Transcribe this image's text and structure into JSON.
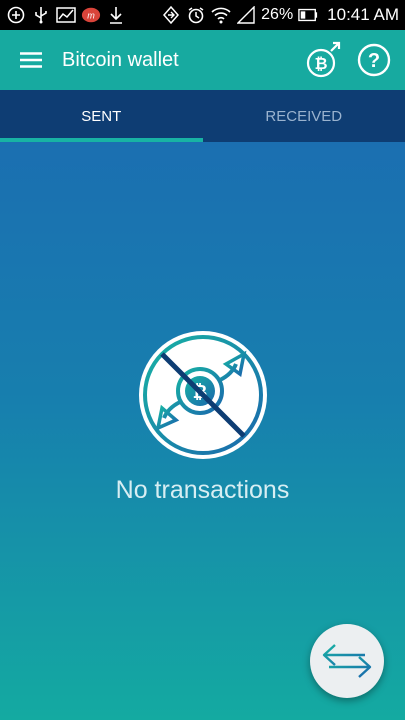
{
  "status_bar": {
    "battery_percent": "26%",
    "time": "10:41 AM",
    "icons": [
      "add-box-icon",
      "usb-icon",
      "chart-icon",
      "app-notification-icon",
      "download-icon",
      "data-sync-icon",
      "alarm-icon",
      "wifi-icon",
      "signal-icon",
      "battery-icon"
    ]
  },
  "app_bar": {
    "title": "Bitcoin wallet",
    "actions": [
      "bitcoin-send-icon",
      "help-icon"
    ]
  },
  "tabs": [
    {
      "label": "SENT",
      "active": true
    },
    {
      "label": "RECEIVED",
      "active": false
    }
  ],
  "empty_state": {
    "message": "No transactions",
    "icon": "no-transactions-icon"
  },
  "fab": {
    "icon": "exchange-arrows-icon"
  },
  "colors": {
    "status_bar": "#000000",
    "app_bar": "#17aaa0",
    "tabs_bg": "#0e3d73",
    "tab_indicator": "#18b3a4",
    "gradient_top": "#1b6fb1",
    "gradient_bottom": "#14aaa1",
    "fab_bg": "#eceff1"
  }
}
